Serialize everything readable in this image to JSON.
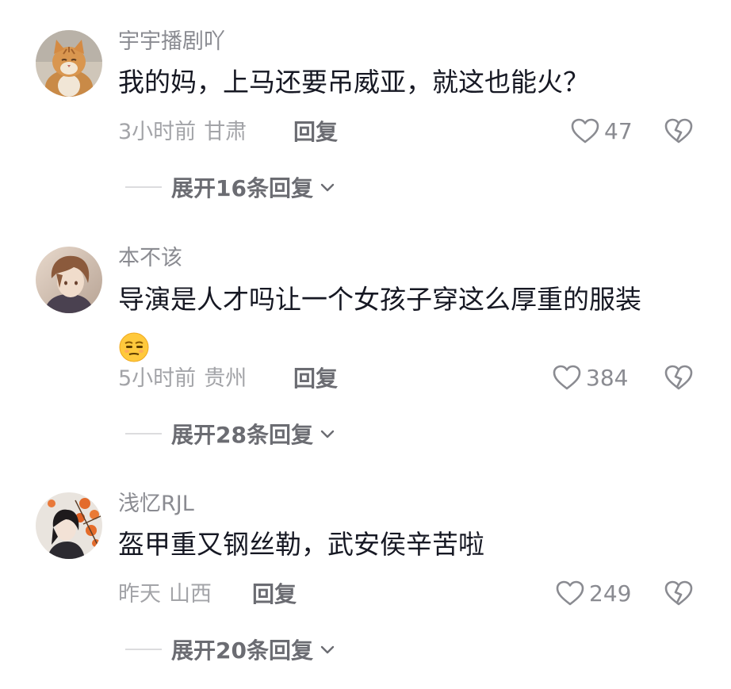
{
  "comments": [
    {
      "username": "宇宇播剧吖",
      "text": "我的妈，上马还要吊威亚，就这也能火？",
      "time": "3小时前",
      "location": "甘肃",
      "reply_label": "回复",
      "likes": "47",
      "expand_label": "展开16条回复",
      "avatar": "cat-avatar"
    },
    {
      "username": "本不该",
      "text": "导演是人才吗让一个女孩子穿这么厚重的服装",
      "emoji": "unamused-face-emoji",
      "time": "5小时前",
      "location": "贵州",
      "reply_label": "回复",
      "likes": "384",
      "expand_label": "展开28条回复",
      "avatar": "anime-boy-avatar"
    },
    {
      "username": "浅忆RJL",
      "text": "盔甲重又钢丝勒，武安侯辛苦啦",
      "time": "昨天",
      "location": "山西",
      "reply_label": "回复",
      "likes": "249",
      "expand_label": "展开20条回复",
      "avatar": "persimmon-avatar"
    }
  ],
  "icons": {
    "like": "heart-outline-icon",
    "dislike": "broken-heart-icon",
    "expand": "chevron-down-icon"
  },
  "colors": {
    "primary_text": "#161823",
    "secondary_text": "#8a8b91",
    "muted_text": "#a3a4a8",
    "action_text": "#6b6c72"
  }
}
